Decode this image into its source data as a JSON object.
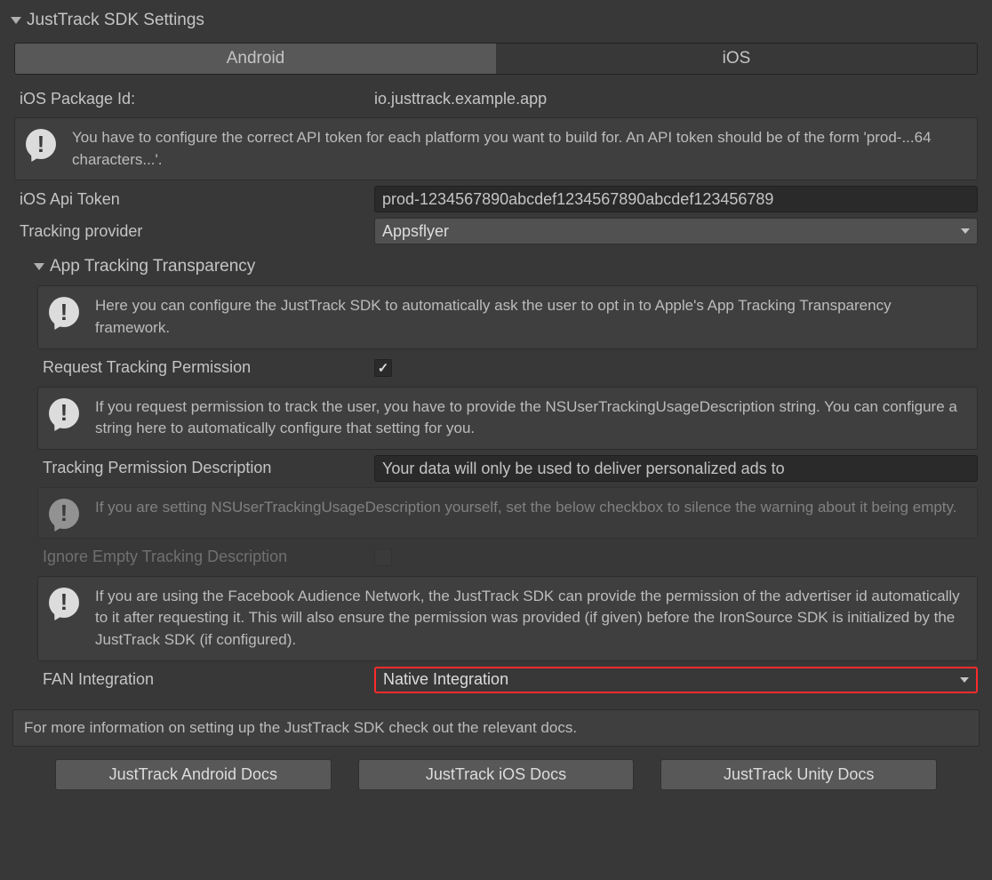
{
  "header": {
    "title": "JustTrack SDK Settings"
  },
  "tabs": {
    "android": "Android",
    "ios": "iOS",
    "active": "android"
  },
  "package": {
    "label": "iOS Package Id:",
    "value": "io.justtrack.example.app"
  },
  "info_api_token": "You have to configure the correct API token for each platform you want to build for. An API token should be of the form 'prod-...64 characters...'.",
  "api_token": {
    "label": "iOS Api Token",
    "value": "prod-1234567890abcdef1234567890abcdef123456789"
  },
  "tracking_provider": {
    "label": "Tracking provider",
    "value": "Appsflyer"
  },
  "att": {
    "header": "App Tracking Transparency",
    "info_intro": "Here you can configure the JustTrack SDK to automatically ask the user to opt in to Apple's App Tracking Transparency framework.",
    "request_label": "Request Tracking Permission",
    "request_checked": true,
    "info_ns": "If you request permission to track the user, you have to provide the NSUserTrackingUsageDescription string. You can configure a string here to automatically configure that setting for you.",
    "desc_label": "Tracking Permission Description",
    "desc_value": "Your data will only be used to deliver personalized ads to",
    "info_silence": "If you are setting NSUserTrackingUsageDescription yourself, set the below checkbox to silence the warning about it being empty.",
    "ignore_label": "Ignore Empty Tracking Description",
    "info_fan": "If you are using the Facebook Audience Network, the JustTrack SDK can provide the permission of the advertiser id automatically to it after requesting it. This will also ensure the permission was provided (if given) before the IronSource SDK is initialized by the JustTrack SDK (if configured).",
    "fan_label": "FAN Integration",
    "fan_value": "Native Integration"
  },
  "footer_note": "For more information on setting up the JustTrack SDK check out the relevant docs.",
  "buttons": {
    "android": "JustTrack Android Docs",
    "ios": "JustTrack iOS Docs",
    "unity": "JustTrack Unity Docs"
  }
}
